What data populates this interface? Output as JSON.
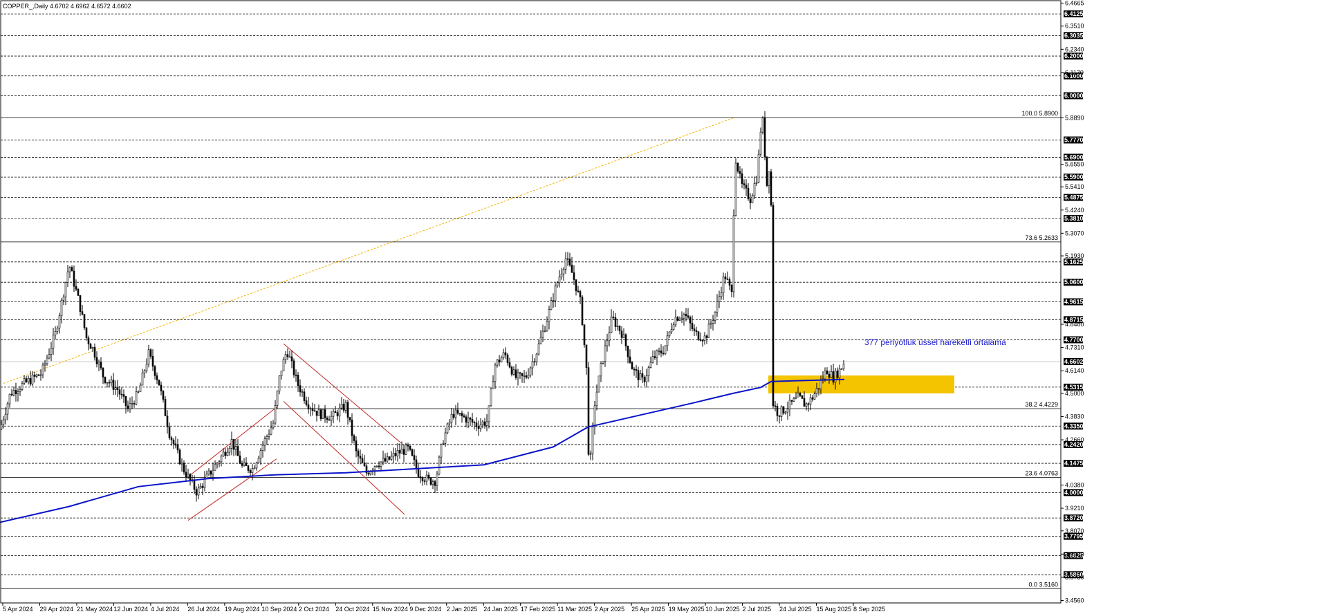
{
  "header": {
    "symbol_info": "COPPER_,Daily  4.6702 4.6962 4.6572 4.6602"
  },
  "colors": {
    "background": "#ffffff",
    "candle": "#000000",
    "ema": "#0a14c8",
    "channel": "#c0261f",
    "fib_diagonal": "#f0b400",
    "zone": "#f5c400",
    "grid": "#000000"
  },
  "chart_data": {
    "type": "candlestick",
    "grid": "horizontal dashed",
    "y_range": [
      3.465,
      6.4665
    ],
    "y_ticks_plain": [
      "6.4665",
      "6.3510",
      "6.2340",
      "6.1170",
      "5.8890",
      "5.6550",
      "5.5410",
      "5.4240",
      "5.3070",
      "5.1930",
      "4.8480",
      "4.7310",
      "4.6140",
      "4.5000",
      "4.3830",
      "4.2660",
      "4.0380",
      "3.9210",
      "3.8070",
      "3.6900",
      "3.5730",
      "3.4560"
    ],
    "y_ticks_boxed": [
      "6.4125",
      "6.3035",
      "6.2000",
      "6.1000",
      "6.0000",
      "5.7770",
      "5.6900",
      "5.5900",
      "5.4875",
      "5.3810",
      "5.1625",
      "5.0600",
      "4.9615",
      "4.8715",
      "4.7700",
      "4.6602",
      "4.5315",
      "4.3350",
      "4.2420",
      "4.1475",
      "4.0000",
      "3.8720",
      "3.7795",
      "3.6825",
      "3.5860"
    ],
    "x_ticks": [
      "5 Apr 2024",
      "29 Apr 2024",
      "21 May 2024",
      "12 Jun 2024",
      "4 Jul 2024",
      "26 Jul 2024",
      "19 Aug 2024",
      "10 Sep 2024",
      "2 Oct 2024",
      "24 Oct 2024",
      "15 Nov 2024",
      "9 Dec 2024",
      "2 Jan 2025",
      "24 Jan 2025",
      "17 Feb 2025",
      "11 Mar 2025",
      "2 Apr 2025",
      "25 Apr 2025",
      "19 May 2025",
      "10 Jun 2025",
      "2 Jul 2025",
      "24 Jul 2025",
      "15 Aug 2025",
      "8 Sep 2025"
    ],
    "fib_levels": [
      {
        "label": "100.0 5.8900",
        "value": 5.89
      },
      {
        "label": "73.6 5.2633",
        "value": 5.2633
      },
      {
        "label": "38.2 4.4229",
        "value": 4.4229
      },
      {
        "label": "23.6 4.0763",
        "value": 4.0763
      },
      {
        "label": "0.0 3.5160",
        "value": 3.516
      }
    ],
    "current_price": 4.6602,
    "ema_period": 377,
    "annotation": "377 periyotluk üssel hareketli ortalama",
    "price_path": [
      [
        0,
        4.32
      ],
      [
        15,
        4.5
      ],
      [
        35,
        4.55
      ],
      [
        60,
        4.6
      ],
      [
        80,
        4.8
      ],
      [
        100,
        5.15
      ],
      [
        115,
        4.95
      ],
      [
        125,
        4.78
      ],
      [
        135,
        4.72
      ],
      [
        150,
        4.58
      ],
      [
        170,
        4.52
      ],
      [
        185,
        4.42
      ],
      [
        200,
        4.5
      ],
      [
        215,
        4.7
      ],
      [
        230,
        4.55
      ],
      [
        245,
        4.3
      ],
      [
        265,
        4.12
      ],
      [
        285,
        4.0
      ],
      [
        300,
        4.08
      ],
      [
        320,
        4.18
      ],
      [
        335,
        4.26
      ],
      [
        350,
        4.13
      ],
      [
        365,
        4.12
      ],
      [
        380,
        4.24
      ],
      [
        395,
        4.35
      ],
      [
        405,
        4.6
      ],
      [
        415,
        4.72
      ],
      [
        430,
        4.55
      ],
      [
        445,
        4.45
      ],
      [
        460,
        4.4
      ],
      [
        480,
        4.38
      ],
      [
        500,
        4.44
      ],
      [
        515,
        4.2
      ],
      [
        530,
        4.1
      ],
      [
        545,
        4.15
      ],
      [
        560,
        4.16
      ],
      [
        575,
        4.2
      ],
      [
        590,
        4.22
      ],
      [
        605,
        4.1
      ],
      [
        620,
        4.06
      ],
      [
        630,
        4.06
      ],
      [
        640,
        4.26
      ],
      [
        655,
        4.4
      ],
      [
        670,
        4.38
      ],
      [
        690,
        4.34
      ],
      [
        705,
        4.36
      ],
      [
        715,
        4.64
      ],
      [
        730,
        4.7
      ],
      [
        745,
        4.58
      ],
      [
        760,
        4.58
      ],
      [
        775,
        4.7
      ],
      [
        790,
        4.86
      ],
      [
        805,
        5.05
      ],
      [
        818,
        5.18
      ],
      [
        828,
        5.1
      ],
      [
        840,
        4.95
      ],
      [
        848,
        4.62
      ],
      [
        852,
        4.08
      ],
      [
        860,
        4.45
      ],
      [
        870,
        4.65
      ],
      [
        885,
        4.88
      ],
      [
        900,
        4.8
      ],
      [
        915,
        4.62
      ],
      [
        930,
        4.56
      ],
      [
        945,
        4.68
      ],
      [
        960,
        4.72
      ],
      [
        975,
        4.88
      ],
      [
        990,
        4.9
      ],
      [
        1005,
        4.8
      ],
      [
        1020,
        4.78
      ],
      [
        1035,
        4.92
      ],
      [
        1048,
        5.1
      ],
      [
        1058,
        5.0
      ],
      [
        1063,
        5.7
      ],
      [
        1072,
        5.55
      ],
      [
        1085,
        5.48
      ],
      [
        1095,
        5.6
      ],
      [
        1102,
        5.92
      ],
      [
        1110,
        5.5
      ],
      [
        1114,
        5.78
      ],
      [
        1118,
        4.45
      ],
      [
        1125,
        4.4
      ],
      [
        1135,
        4.42
      ],
      [
        1145,
        4.45
      ],
      [
        1155,
        4.48
      ],
      [
        1165,
        4.44
      ],
      [
        1175,
        4.48
      ],
      [
        1185,
        4.54
      ],
      [
        1195,
        4.62
      ],
      [
        1205,
        4.58
      ],
      [
        1215,
        4.62
      ],
      [
        1221,
        4.66
      ]
    ],
    "ema_path": [
      [
        0,
        3.85
      ],
      [
        100,
        3.93
      ],
      [
        200,
        4.03
      ],
      [
        300,
        4.07
      ],
      [
        400,
        4.09
      ],
      [
        500,
        4.1
      ],
      [
        600,
        4.12
      ],
      [
        700,
        4.14
      ],
      [
        800,
        4.23
      ],
      [
        850,
        4.33
      ],
      [
        900,
        4.37
      ],
      [
        1000,
        4.45
      ],
      [
        1060,
        4.5
      ],
      [
        1100,
        4.53
      ],
      [
        1115,
        4.56
      ],
      [
        1221,
        4.57
      ]
    ],
    "zone_range": [
      4.5,
      4.59
    ],
    "zone_span": [
      1111,
      1380
    ],
    "fib_diagonal": [
      [
        5,
        4.55
      ],
      [
        1062,
        5.89
      ]
    ],
    "channel_up": [
      [
        [
          272,
          4.08
        ],
        [
          400,
          4.43
        ]
      ],
      [
        [
          272,
          3.86
        ],
        [
          400,
          4.17
        ]
      ]
    ],
    "channel_down": [
      [
        [
          410,
          4.75
        ],
        [
          580,
          4.25
        ]
      ],
      [
        [
          410,
          4.46
        ],
        [
          585,
          3.89
        ]
      ]
    ]
  }
}
